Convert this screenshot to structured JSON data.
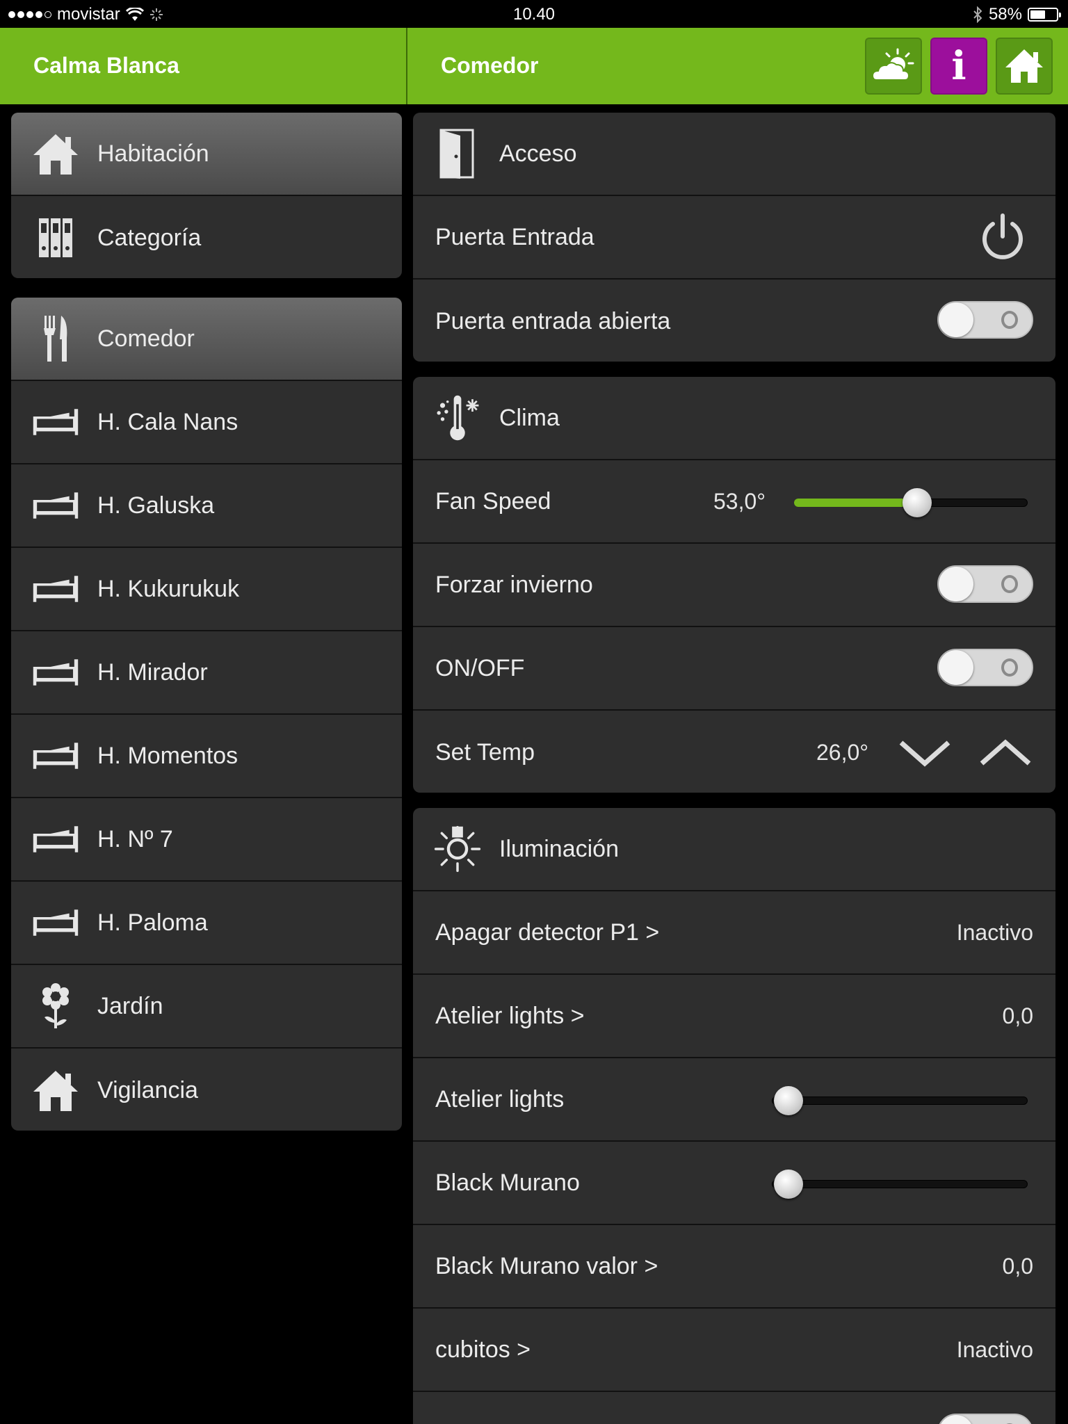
{
  "status_bar": {
    "carrier": "movistar",
    "time": "10.40",
    "battery": "58%",
    "battery_level": 0.58
  },
  "header": {
    "app_title": "Calma Blanca",
    "room_title": "Comedor",
    "buttons": {
      "weather_icon": "weather-icon",
      "info_glyph": "i",
      "home_icon": "home-icon"
    }
  },
  "nav_modes": [
    {
      "label": "Habitación",
      "icon": "house-icon",
      "selected": true
    },
    {
      "label": "Categoría",
      "icon": "binders-icon",
      "selected": false
    }
  ],
  "rooms": [
    {
      "label": "Comedor",
      "icon": "cutlery-icon",
      "selected": true
    },
    {
      "label": "H. Cala Nans",
      "icon": "bed-icon"
    },
    {
      "label": "H. Galuska",
      "icon": "bed-icon"
    },
    {
      "label": "H. Kukurukuk",
      "icon": "bed-icon"
    },
    {
      "label": "H. Mirador",
      "icon": "bed-icon"
    },
    {
      "label": "H. Momentos",
      "icon": "bed-icon"
    },
    {
      "label": "H. Nº 7",
      "icon": "bed-icon"
    },
    {
      "label": "H. Paloma",
      "icon": "bed-icon"
    },
    {
      "label": "Jardín",
      "icon": "flower-icon"
    },
    {
      "label": "Vigilancia",
      "icon": "house-icon"
    }
  ],
  "acceso": {
    "title": "Acceso",
    "puerta_entrada": {
      "label": "Puerta Entrada"
    },
    "puerta_abierta": {
      "label": "Puerta entrada abierta",
      "on": false
    }
  },
  "clima": {
    "title": "Clima",
    "fan_speed": {
      "label": "Fan Speed",
      "value": "53,0°",
      "level": 0.53
    },
    "forzar_invierno": {
      "label": "Forzar invierno",
      "on": false
    },
    "on_off": {
      "label": "ON/OFF",
      "on": false
    },
    "set_temp": {
      "label": "Set Temp",
      "value": "26,0°"
    }
  },
  "iluminacion": {
    "title": "Iluminación",
    "rows": [
      {
        "label": "Apagar detector P1 >",
        "value": "Inactivo"
      },
      {
        "label": "Atelier lights >",
        "value": "0,0"
      },
      {
        "label": "Atelier lights",
        "level": 0.0
      },
      {
        "label": "Black Murano",
        "level": 0.0
      },
      {
        "label": "Black Murano valor >",
        "value": "0,0"
      },
      {
        "label": "cubitos >",
        "value": "Inactivo"
      }
    ]
  },
  "colors": {
    "accent_green": "#74b81c",
    "info_purple": "#9c0f9c",
    "panel": "#2e2e2e"
  }
}
